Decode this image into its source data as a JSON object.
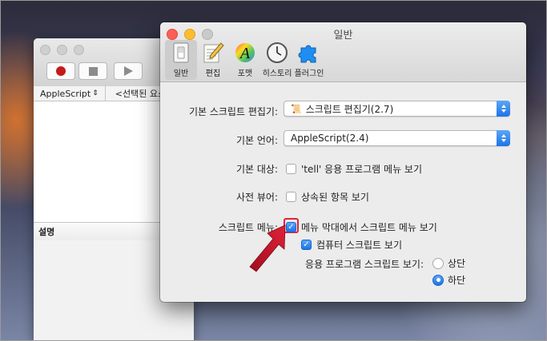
{
  "editor": {
    "language_popup": "AppleScript",
    "element_popup": "<선택된 요소 없음>",
    "description_label": "설명"
  },
  "prefs": {
    "title": "일반",
    "toolbar": [
      {
        "label": "일반",
        "icon": "switch-icon",
        "selected": true
      },
      {
        "label": "편집",
        "icon": "pencil-paper-icon",
        "selected": false
      },
      {
        "label": "포맷",
        "icon": "font-a-icon",
        "selected": false
      },
      {
        "label": "히스토리",
        "icon": "clock-icon",
        "selected": false
      },
      {
        "label": "플러그인",
        "icon": "puzzle-icon",
        "selected": false
      }
    ],
    "default_editor": {
      "label": "기본 스크립트 편집기:",
      "value": "스크립트 편집기(2.7)"
    },
    "default_language": {
      "label": "기본 언어:",
      "value": "AppleScript(2.4)"
    },
    "default_target": {
      "label": "기본 대상:",
      "checkbox_text": "'tell' 응용 프로그램 메뉴 보기",
      "checked": false
    },
    "dictionary_viewer": {
      "label": "사전 뷰어:",
      "checkbox_text": "상속된 항목 보기",
      "checked": false
    },
    "script_menu": {
      "label": "스크립트 메뉴:",
      "show_in_menubar": {
        "text": "메뉴 막대에서 스크립트 메뉴 보기",
        "checked": true
      },
      "computer_scripts": {
        "text": "컴퓨터 스크립트 보기",
        "checked": true
      },
      "app_scripts": {
        "label": "응용 프로그램 스크립트 보기:",
        "options": [
          "상단",
          "하단"
        ],
        "selected": "하단"
      }
    }
  },
  "colors": {
    "accent": "#1c74e6",
    "annotation": "#e0223a"
  }
}
